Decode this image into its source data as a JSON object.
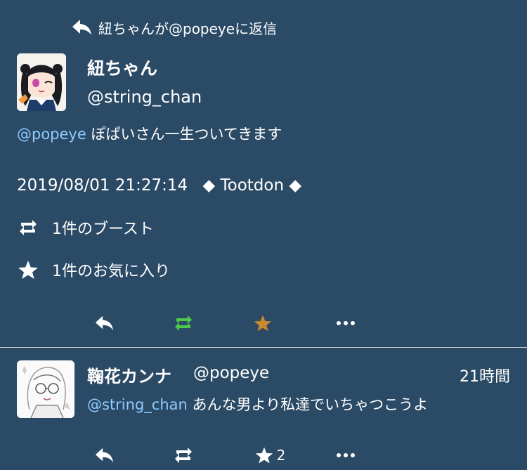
{
  "colors": {
    "background": "#2b4a66",
    "mention": "#8ecbff",
    "boost_active": "#4ec94a",
    "favourite_active": "#c98a2e",
    "divider": "#c8d3dc"
  },
  "reply_context": {
    "icon": "reply-icon",
    "text": "紐ちゃんが@popeyeに返信"
  },
  "status": {
    "avatar": "avatar-anime-girl",
    "display_name": "紐ちゃん",
    "handle": "@string_chan",
    "mention": "@popeye",
    "text": " ぽぱいさん一生ついてきます",
    "date": "2019/08/01 21:27:14",
    "via": "◆ Tootdon ◆",
    "boosts_label": "1件のブースト",
    "favourites_label": "1件のお気に入り",
    "actions": [
      "reply-icon",
      "boost-icon",
      "favourite-icon",
      "more-icon"
    ]
  },
  "reply": {
    "avatar": "avatar-sketch-girl",
    "display_name": "鞠花カンナ",
    "handle": "@popeye",
    "time": "21時間",
    "mention": "@string_chan",
    "text": " あんな男より私達でいちゃつこうよ",
    "favourite_count": "2",
    "actions": [
      "reply-icon",
      "boost-icon",
      "favourite-icon",
      "more-icon"
    ]
  }
}
